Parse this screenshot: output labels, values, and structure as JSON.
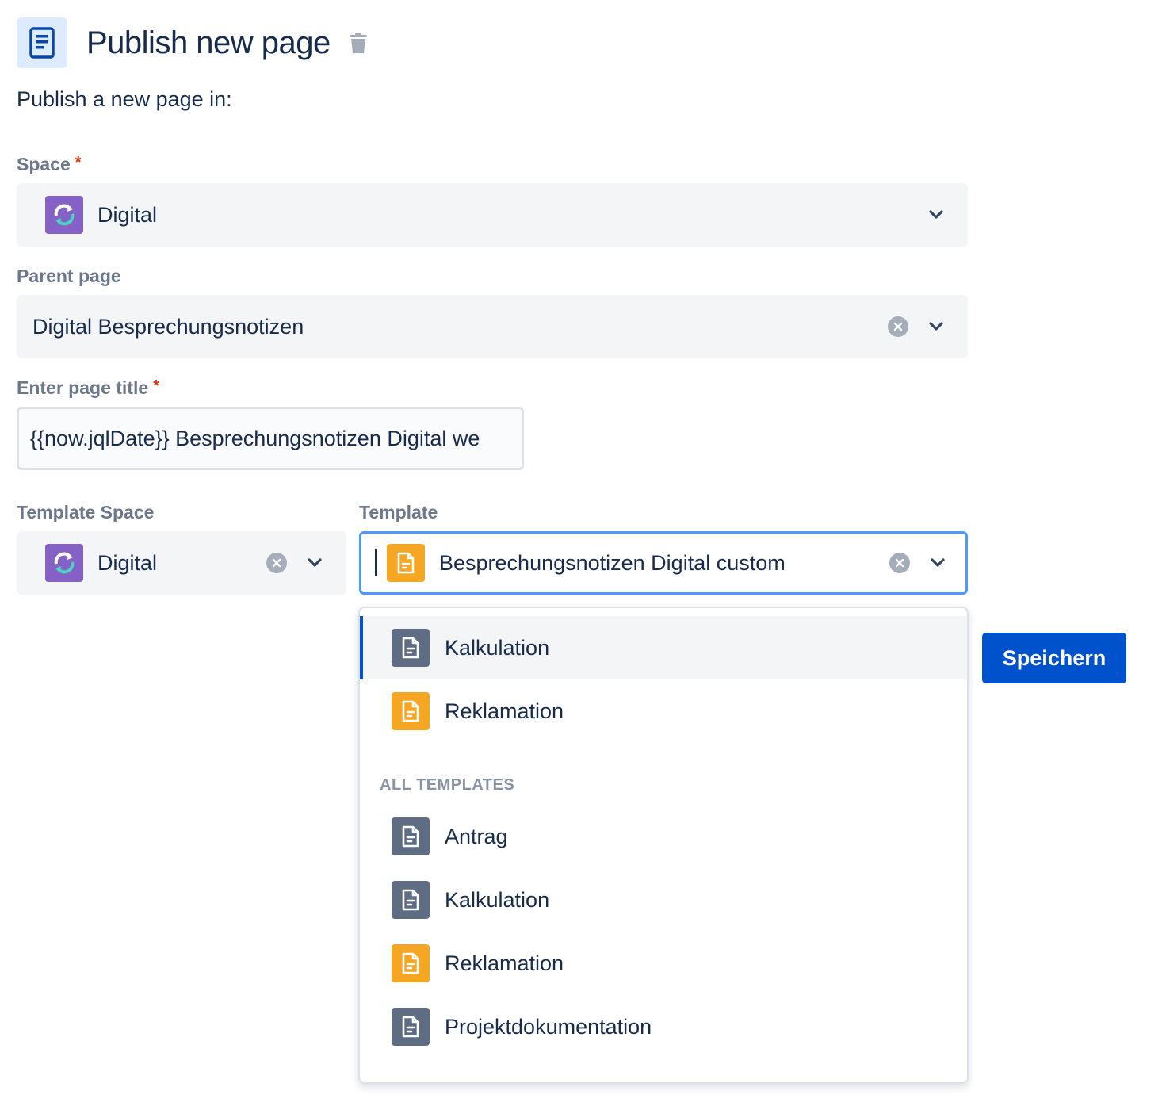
{
  "header": {
    "title": "Publish new page"
  },
  "subtitle": "Publish a new page in:",
  "space_field": {
    "label": "Space",
    "required_mark": "*",
    "value": "Digital"
  },
  "parent_field": {
    "label": "Parent page",
    "value": "Digital Besprechungsnotizen"
  },
  "title_field": {
    "label": "Enter page title",
    "required_mark": "*",
    "value": "{{now.jqlDate}} Besprechungsnotizen Digital we"
  },
  "template_space_field": {
    "label": "Template Space",
    "value": "Digital"
  },
  "template_field": {
    "label": "Template",
    "value": "Besprechungsnotizen Digital custom"
  },
  "dropdown": {
    "recent": [
      {
        "label": "Kalkulation",
        "icon": "page-template-icon",
        "color": "#5E6C84"
      },
      {
        "label": "Reklamation",
        "icon": "page-template-icon",
        "color": "#F5A623"
      }
    ],
    "group_header": "ALL TEMPLATES",
    "all": [
      {
        "label": "Antrag",
        "icon": "page-template-icon",
        "color": "#5E6C84"
      },
      {
        "label": "Kalkulation",
        "icon": "page-template-icon",
        "color": "#5E6C84"
      },
      {
        "label": "Reklamation",
        "icon": "page-template-icon",
        "color": "#F5A623"
      },
      {
        "label": "Projektdokumentation",
        "icon": "page-template-icon",
        "color": "#5E6C84"
      }
    ]
  },
  "save_button": "Speichern",
  "colors": {
    "primary": "#0052CC",
    "focus_border": "#4C9AFF",
    "required": "#DE350B",
    "space_avatar": "#8661C5"
  }
}
